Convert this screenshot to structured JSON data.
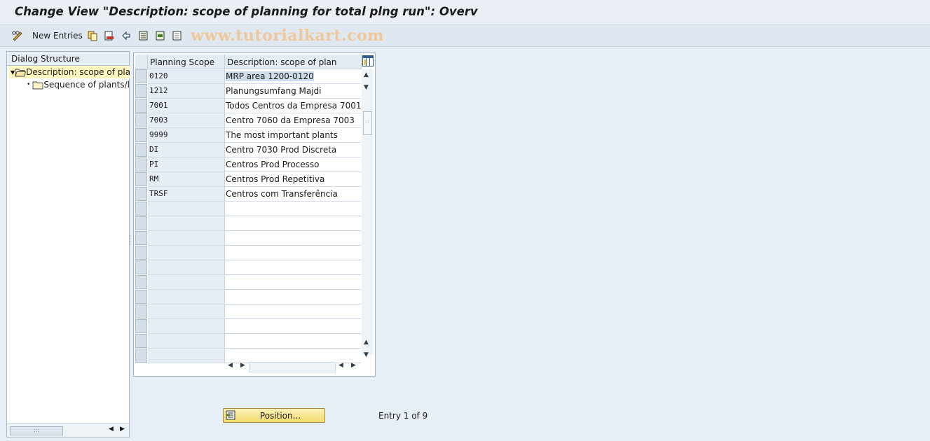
{
  "window": {
    "title": "Change View \"Description: scope of planning for total plng run\": Overv"
  },
  "toolbar": {
    "new_entries_label": "New Entries",
    "watermark": "www.tutorialkart.com",
    "icons": [
      "glasses-pencil-icon",
      "copy-icon",
      "delete-icon",
      "undo-icon",
      "select-all-icon",
      "select-block-icon",
      "deselect-all-icon"
    ]
  },
  "dialog_structure": {
    "header": "Dialog Structure",
    "items": [
      {
        "label": "Description: scope of pla",
        "level": 0,
        "expanded": true,
        "selected": true,
        "icon": "open-folder-icon"
      },
      {
        "label": "Sequence of plants/l",
        "level": 1,
        "expanded": false,
        "selected": false,
        "icon": "folder-icon"
      }
    ]
  },
  "table": {
    "columns": [
      "Planning Scope",
      "Description: scope of plan"
    ],
    "rows": [
      {
        "scope": "0120",
        "description": "MRP area 1200-0120"
      },
      {
        "scope": "1212",
        "description": "Planungsumfang Majdi"
      },
      {
        "scope": "7001",
        "description": "Todos Centros da Empresa 7001"
      },
      {
        "scope": "7003",
        "description": "Centro 7060 da Empresa 7003"
      },
      {
        "scope": "9999",
        "description": "The most important plants"
      },
      {
        "scope": "DI",
        "description": "Centro 7030 Prod Discreta"
      },
      {
        "scope": "PI",
        "description": "Centros Prod Processo"
      },
      {
        "scope": "RM",
        "description": "Centros Prod Repetitiva"
      },
      {
        "scope": "TRSF",
        "description": "Centros com Transferência"
      }
    ],
    "empty_rows": 11
  },
  "footer": {
    "position_button": "Position...",
    "entry_info": "Entry 1 of 9"
  },
  "colors": {
    "selection": "#fff6bf",
    "button": "#f3db6b",
    "key_column": "#e6edf4"
  }
}
